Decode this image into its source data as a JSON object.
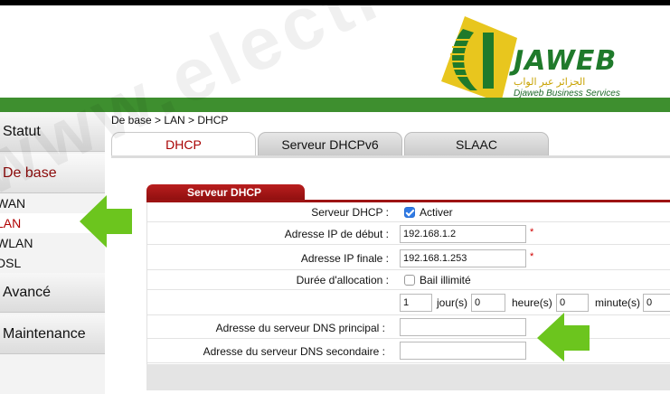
{
  "header": {
    "brand": "JAWEB",
    "brand_arabic": "الجزائر عبر الواب",
    "brand_sub": "Djaweb Business Services",
    "watermark": "www.electrodz.com"
  },
  "sidebar": {
    "items": [
      {
        "label": "Statut"
      },
      {
        "label": "De base"
      },
      {
        "label": "Avancé"
      },
      {
        "label": "Maintenance"
      }
    ],
    "subitems": [
      {
        "label": "WAN"
      },
      {
        "label": "LAN"
      },
      {
        "label": "WLAN"
      },
      {
        "label": "DSL"
      }
    ]
  },
  "breadcrumb": "De base > LAN > DHCP",
  "tabs": [
    {
      "label": "DHCP"
    },
    {
      "label": "Serveur DHCPv6"
    },
    {
      "label": "SLAAC"
    }
  ],
  "panel": {
    "title": "Serveur DHCP",
    "dhcp_server": {
      "label": "Serveur DHCP :",
      "option": "Activer",
      "checked": true
    },
    "start_ip": {
      "label": "Adresse IP de début :",
      "value": "192.168.1.2",
      "required": "*"
    },
    "end_ip": {
      "label": "Adresse IP finale :",
      "value": "192.168.1.253",
      "required": "*"
    },
    "lease": {
      "label": "Durée d'allocation :",
      "unlimited_label": "Bail illimité",
      "unlimited_checked": false,
      "days_value": "1",
      "days_label": "jour(s)",
      "hours_value": "0",
      "hours_label": "heure(s)",
      "minutes_value": "0",
      "minutes_label": "minute(s)",
      "seconds_value": "0"
    },
    "dns_primary": {
      "label": "Adresse du serveur DNS principal :",
      "value": ""
    },
    "dns_secondary": {
      "label": "Adresse du serveur DNS secondaire :",
      "value": ""
    }
  },
  "colors": {
    "accent_red": "#a80000",
    "header_green": "#3e8f2f",
    "arrow_green": "#6cc51e",
    "checkbox_blue": "#2f7ae5"
  },
  "icons": [
    "jaweb-logo-icon",
    "checkbox-checked-icon",
    "checkbox-unchecked-icon",
    "green-arrow-right-icon",
    "green-arrow-down-icon"
  ]
}
